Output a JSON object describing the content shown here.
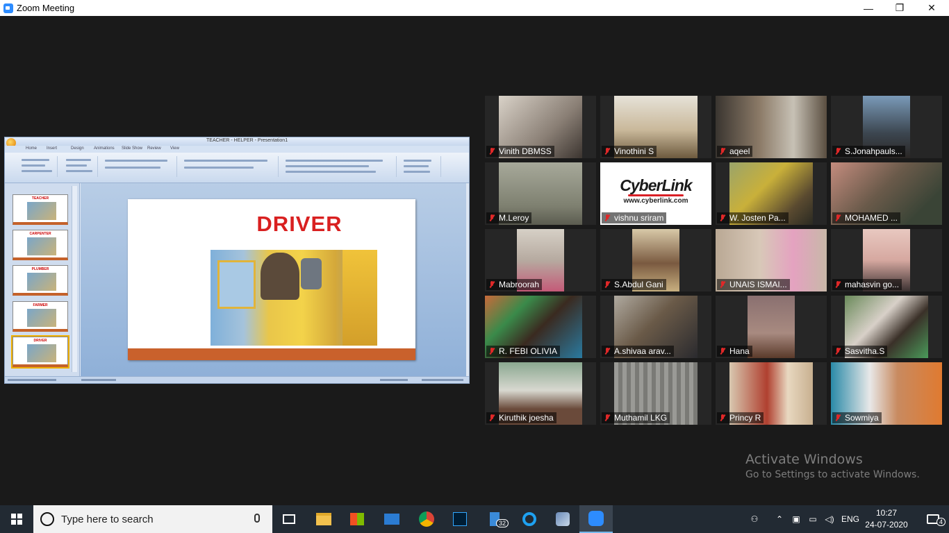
{
  "window": {
    "title": "Zoom Meeting"
  },
  "controls": {
    "minimize": "—",
    "restore": "❐",
    "close": "✕"
  },
  "shared_screen": {
    "slide_title": "DRIVER",
    "ppt_title": "TEACHER - HELPER - Presentation1",
    "ppt_tabs": [
      "Home",
      "Insert",
      "Design",
      "Animations",
      "Slide Show",
      "Review",
      "View"
    ],
    "thumbnails": [
      "TEACHER",
      "CARPENTER",
      "PLUMBER",
      "FARMER",
      "DRIVER"
    ]
  },
  "participants": [
    {
      "name": "Vinith DBMSS",
      "muted": true
    },
    {
      "name": "Vinothini S",
      "muted": true
    },
    {
      "name": "aqeel",
      "muted": true
    },
    {
      "name": "S.Jonahpauls...",
      "muted": true
    },
    {
      "name": "M.Leroy",
      "muted": true
    },
    {
      "name": "vishnu sriram",
      "muted": true
    },
    {
      "name": "W. Josten Pa...",
      "muted": true
    },
    {
      "name": "MOHAMED ...",
      "muted": true
    },
    {
      "name": "Mabroorah",
      "muted": true
    },
    {
      "name": "S.Abdul Gani",
      "muted": true
    },
    {
      "name": "UNAIS ISMAI...",
      "muted": true
    },
    {
      "name": "mahasvin go...",
      "muted": true
    },
    {
      "name": "R. FEBI OLIVIA",
      "muted": true
    },
    {
      "name": "A.shivaa arav...",
      "muted": true
    },
    {
      "name": "Hana",
      "muted": true
    },
    {
      "name": "Sasvitha.S",
      "muted": true
    },
    {
      "name": "Kiruthik joesha",
      "muted": true
    },
    {
      "name": "Muthamil LKG",
      "muted": true
    },
    {
      "name": "Princy R",
      "muted": true
    },
    {
      "name": "Sowmiya",
      "muted": true
    }
  ],
  "cyberlink": {
    "logo": "CyberLink",
    "url": "www.cyberlink.com"
  },
  "activation": {
    "title": "Activate Windows",
    "subtitle": "Go to Settings to activate Windows."
  },
  "taskbar": {
    "search_placeholder": "Type here to search",
    "language": "ENG",
    "time": "10:27",
    "date": "24-07-2020",
    "notification_count": "4",
    "app_badge": "32"
  },
  "colors": {
    "accent": "#2d8cff",
    "muted_mic": "#e02828",
    "slide_title": "#d92020",
    "taskbar": "#222a33"
  }
}
